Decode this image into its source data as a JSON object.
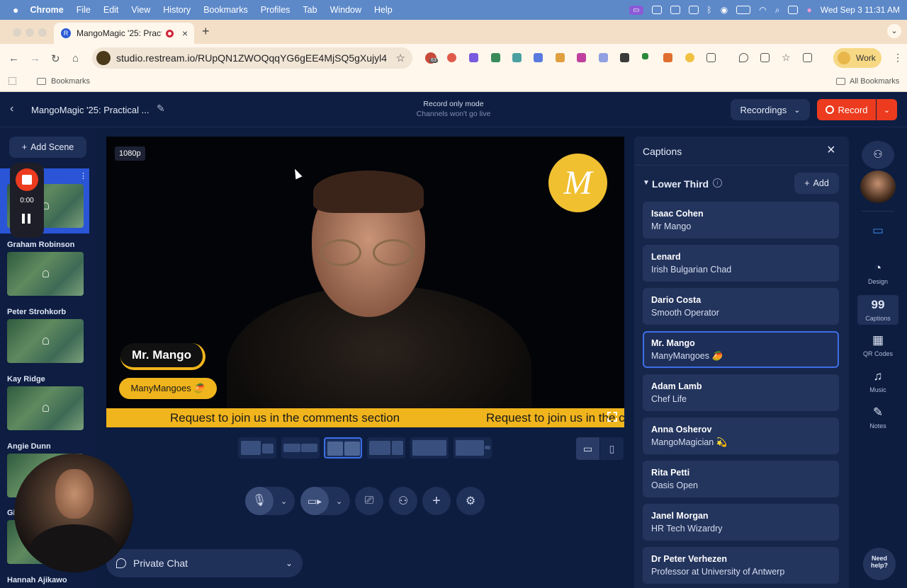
{
  "menubar": {
    "app": "Chrome",
    "items": [
      "File",
      "Edit",
      "View",
      "History",
      "Bookmarks",
      "Profiles",
      "Tab",
      "Window",
      "Help"
    ],
    "datetime": "Wed Sep 3  11:31 AM"
  },
  "browser": {
    "tab_title": "MangoMagic '25: Practica",
    "url": "studio.restream.io/RUpQN1ZWOQqqYG6gEE4MjSQ5gXujyl4",
    "profile": "Work",
    "bookmarks_label": "Bookmarks",
    "all_bookmarks": "All Bookmarks",
    "ext_badge": "63",
    "colors": {
      "tabbar": "#f3dfc7",
      "toolbar": "#fff7ec"
    }
  },
  "studio": {
    "project_title": "MangoMagic '25: Practical ...",
    "mode_title": "Record only mode",
    "mode_sub": "Channels won't go live",
    "recordings_label": "Recordings",
    "record_label": "Record",
    "add_scene": "Add Scene",
    "recorder": {
      "time": "0:00"
    },
    "scenes": [
      {
        "name": "Graham Robinson"
      },
      {
        "name": "Peter Strohkorb"
      },
      {
        "name": "Kay Ridge"
      },
      {
        "name": "Angie Dunn"
      },
      {
        "name": "Gi"
      },
      {
        "name": "Hannah Ajikawo"
      }
    ],
    "stage": {
      "resolution": "1080p",
      "logo_letter": "M",
      "lower_third": {
        "name": "Mr. Mango",
        "title": "ManyMangoes 🥭"
      },
      "ticker": "Request to join us in the comments section",
      "ticker_repeat": "Request to join us in the c"
    },
    "private_chat": "Private Chat",
    "need_help": "Need help?"
  },
  "captions": {
    "title": "Captions",
    "section": "Lower Third",
    "add_label": "Add",
    "items": [
      {
        "name": "Isaac Cohen",
        "title": "Mr Mango"
      },
      {
        "name": "Lenard",
        "title": "Irish Bulgarian Chad"
      },
      {
        "name": "Dario Costa",
        "title": "Smooth Operator"
      },
      {
        "name": "Mr. Mango",
        "title": "ManyMangoes 🥭"
      },
      {
        "name": "Adam Lamb",
        "title": "Chef Life"
      },
      {
        "name": "Anna Osherov",
        "title": "MangoMagician 💫"
      },
      {
        "name": "Rita Petti",
        "title": "Oasis Open"
      },
      {
        "name": "Janel Morgan",
        "title": "HR Tech Wizardry"
      },
      {
        "name": "Dr Peter Verhezen",
        "title": "Professor at University of Antwerp"
      }
    ],
    "selected_index": 3
  },
  "rail": [
    "Design",
    "Captions",
    "QR Codes",
    "Music",
    "Notes"
  ],
  "colors": {
    "accent": "#3d6ee6",
    "record": "#ec3b1e",
    "mango": "#f0b41c",
    "bg": "#0d1d40"
  }
}
